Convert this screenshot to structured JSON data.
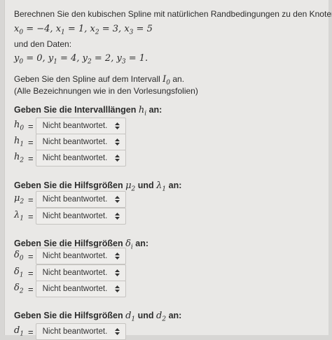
{
  "intro": {
    "line1": "Berechnen Sie den kubischen Spline mit natürlichen Randbedingungen zu den Knoten:",
    "knots": [
      {
        "var": "x",
        "sub": "0",
        "val": "−4"
      },
      {
        "var": "x",
        "sub": "1",
        "val": "1"
      },
      {
        "var": "x",
        "sub": "2",
        "val": "3"
      },
      {
        "var": "x",
        "sub": "3",
        "val": "5"
      }
    ],
    "data_label": "und den Daten:",
    "data": [
      {
        "var": "y",
        "sub": "0",
        "val": "0"
      },
      {
        "var": "y",
        "sub": "1",
        "val": "4"
      },
      {
        "var": "y",
        "sub": "2",
        "val": "2"
      },
      {
        "var": "y",
        "sub": "3",
        "val": "1"
      }
    ],
    "interval_text": "Geben Sie den Spline auf dem Intervall",
    "interval_var": "I",
    "interval_sub": "0",
    "interval_suffix": "an.",
    "note": "(Alle Bezeichnungen wie in den Vorlesungsfolien)"
  },
  "sections": [
    {
      "title_pre": "Geben Sie die Intervalllängen",
      "title_math": "h",
      "title_math_sub": "i",
      "title_mid": "",
      "title_math2": "",
      "title_math2_sub": "",
      "title_post": "an:",
      "fields": [
        {
          "var": "h",
          "sub": "0",
          "value": "Nicht beantwortet."
        },
        {
          "var": "h",
          "sub": "1",
          "value": "Nicht beantwortet."
        },
        {
          "var": "h",
          "sub": "2",
          "value": "Nicht beantwortet."
        }
      ]
    },
    {
      "title_pre": "Geben Sie die Hilfsgrößen",
      "title_math": "μ",
      "title_math_sub": "2",
      "title_mid": "und",
      "title_math2": "λ",
      "title_math2_sub": "1",
      "title_post": "an:",
      "fields": [
        {
          "var": "μ",
          "sub": "2",
          "value": "Nicht beantwortet."
        },
        {
          "var": "λ",
          "sub": "1",
          "value": "Nicht beantwortet."
        }
      ]
    },
    {
      "title_pre": "Geben Sie die Hilfsgrößen",
      "title_math": "δ",
      "title_math_sub": "i",
      "title_mid": "",
      "title_math2": "",
      "title_math2_sub": "",
      "title_post": "an:",
      "fields": [
        {
          "var": "δ",
          "sub": "0",
          "value": "Nicht beantwortet."
        },
        {
          "var": "δ",
          "sub": "1",
          "value": "Nicht beantwortet."
        },
        {
          "var": "δ",
          "sub": "2",
          "value": "Nicht beantwortet."
        }
      ]
    },
    {
      "title_pre": "Geben Sie die Hilfsgrößen",
      "title_math": "d",
      "title_math_sub": "1",
      "title_mid": "und",
      "title_math2": "d",
      "title_math2_sub": "2",
      "title_post": "an:",
      "fields": [
        {
          "var": "d",
          "sub": "1",
          "value": "Nicht beantwortet."
        }
      ]
    }
  ],
  "icons": {
    "dropdown": "updown-caret-icon"
  }
}
